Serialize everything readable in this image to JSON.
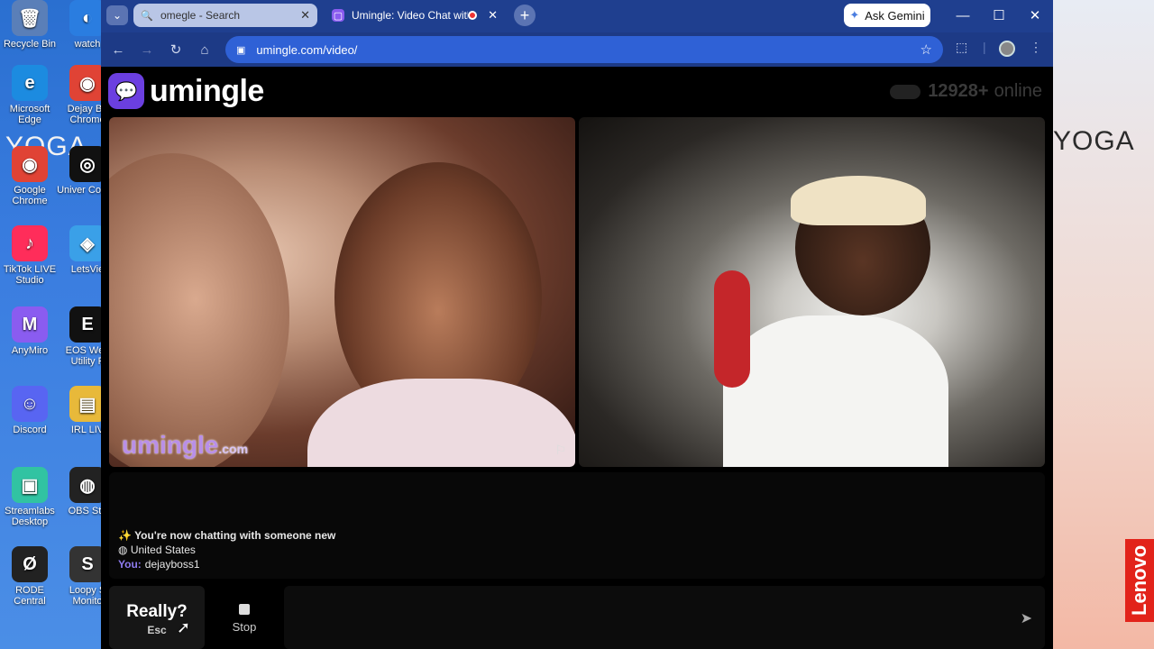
{
  "desktop": {
    "icons_left": [
      {
        "label": "Recycle Bin",
        "glyph": "🗑",
        "color": "#5a7fb8"
      },
      {
        "label": "Microsoft Edge",
        "glyph": "e",
        "color": "#1c8be0"
      },
      {
        "label": "Google Chrome",
        "glyph": "◉",
        "color": "#e04335"
      },
      {
        "label": "TikTok LIVE Studio",
        "glyph": "♪",
        "color": "#ff2d5a"
      },
      {
        "label": "AnyMiro",
        "glyph": "M",
        "color": "#8a5cf0"
      },
      {
        "label": "Discord",
        "glyph": "☺",
        "color": "#5865f2"
      },
      {
        "label": "Streamlabs Desktop",
        "glyph": "▣",
        "color": "#31c3a2"
      },
      {
        "label": "RODE Central",
        "glyph": "Ø",
        "color": "#222222"
      }
    ],
    "icons_col2": [
      {
        "label": "watch",
        "glyph": "◐",
        "color": "#2a7de0"
      },
      {
        "label": "Dejay Bo Chrome",
        "glyph": "◉",
        "color": "#e04335"
      },
      {
        "label": "Univer Contro",
        "glyph": "◎",
        "color": "#111111"
      },
      {
        "label": "LetsVie",
        "glyph": "◈",
        "color": "#3aa0e8"
      },
      {
        "label": "EOS Web Utility F",
        "glyph": "E",
        "color": "#111111"
      },
      {
        "label": "IRL LIV",
        "glyph": "▤",
        "color": "#e8b93a"
      },
      {
        "label": "OBS Stu",
        "glyph": "◍",
        "color": "#222222"
      },
      {
        "label": "Loopy S Monito",
        "glyph": "S",
        "color": "#333333"
      }
    ],
    "yoga_left": "YOGA",
    "yoga_right": "YOGA",
    "brand": "Lenovo"
  },
  "browser": {
    "tabs": [
      {
        "title": "omegle - Search",
        "favicon": "search-icon"
      },
      {
        "title": "Umingle: Video Chat with St",
        "favicon": "umingle-icon"
      }
    ],
    "ask_gemini": "Ask Gemini",
    "url": "umingle.com/video/"
  },
  "page": {
    "logo_text": "umingle",
    "online_count": "12928+",
    "online_label": "online",
    "watermark": "umingle",
    "watermark_suffix": ".com",
    "chat": {
      "new_chat": "You're now chatting with someone new",
      "country": "United States",
      "you_label": "You:",
      "you_name": "dejayboss1"
    },
    "esc_button": {
      "label": "Really?",
      "key": "Esc"
    },
    "stop_button": "Stop"
  },
  "colors": {
    "accent": "#6b3fe0",
    "omnibox": "#2f61d6",
    "tabstrip": "#1f3f8f"
  }
}
